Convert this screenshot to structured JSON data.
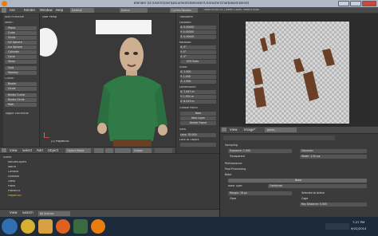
{
  "window": {
    "title": "Blender [D:\\Users\\User\\Documents\\Blender\\Character\\charbaked.blend]"
  },
  "info_header": {
    "menus": [
      "File",
      "Render",
      "Window",
      "Help"
    ],
    "layout": "Default",
    "scene": "Scene",
    "engine": "Cycles Render",
    "stats": "Time:00:00.00 | Mem:0.80M, Peak:0.80M"
  },
  "tool_shelf": {
    "add_primitive_label": "Add Primitive",
    "mesh_label": "Mesh:",
    "mesh_items": [
      "Plane",
      "Cube",
      "Circle",
      "UV Sphere",
      "Ico Sphere",
      "Cylinder",
      "Cone",
      "Torus",
      "Grid",
      "Monkey"
    ],
    "curve_label": "Curve:",
    "curve_items": [
      "Bezier",
      "Circle",
      "Nurbs Curve",
      "Nurbs Circle",
      "Path"
    ],
    "toggle_label": "Toggle Editmode"
  },
  "viewport": {
    "view_label": "User Persp",
    "object_label": "(1) Player001",
    "header_menus": [
      "View",
      "Select",
      "Add",
      "Object"
    ],
    "mode": "Object Mode",
    "orientation": "Global"
  },
  "n_panel": {
    "transform": "Transform",
    "location": "Location:",
    "loc": [
      "X:",
      "0.00000",
      "Y:",
      "0.00000",
      "Z:",
      "0.00000"
    ],
    "rotation": "Rotation:",
    "rot": [
      "X:",
      "0°",
      "Y:",
      "0°",
      "Z:",
      "0°"
    ],
    "rot_mode": "XYZ Euler",
    "scale": "Scale:",
    "scl": [
      "X:",
      "1.000",
      "Y:",
      "1.000",
      "Z:",
      "1.000"
    ],
    "dimensions": "Dimensions:",
    "dims": [
      "X:",
      "7.847 m",
      "Y:",
      "1.954 m",
      "Z:",
      "8.513 m"
    ],
    "grease_pencil": "Grease Pencil",
    "new_label": "New",
    "new_layer": "New Layer",
    "delete_frame": "Delete Frame",
    "view_label": "View",
    "lens_label": "Lens:",
    "lens_value": "35.000",
    "lock_label": "Lock to Object:"
  },
  "image_editor": {
    "header_menus": [
      "View",
      "Image*"
    ],
    "image_name": "pants"
  },
  "properties": {
    "sampling": "Sampling",
    "exposure_label": "Exposure:",
    "exposure_value": "1.000",
    "filter_label": "Gaussian",
    "transparent_label": "Transparent",
    "width_label": "Width:",
    "width_value": "1.50 px",
    "performance": "Performance",
    "post_processing": "Post Processing",
    "bake": "Bake",
    "bake_button": "Bake",
    "bake_type_label": "Bake Type:",
    "bake_type_value": "Combined",
    "margin_label": "Margin:",
    "margin_value": "16 px",
    "selected_to_active": "Selected to Active",
    "clear_label": "Clear",
    "cage_label": "Cage",
    "ray_distance": "Ray Distance:",
    "ray_value": "0.000"
  },
  "outliner": {
    "rows": [
      "Scene",
      "RenderLayers",
      "World",
      "Camera",
      "Eyeballs",
      "Lamp",
      "Plane",
      "Plane001",
      "Player001"
    ],
    "footer": [
      "View",
      "Search",
      "All Scenes"
    ]
  },
  "taskbar": {
    "time": "7:27 PM",
    "date": "9/22/2014"
  },
  "colors": {
    "blender_bg": "#393939",
    "shirt": "#2e7a45",
    "skin": "#c9a98a",
    "taskbar": "#1c2a3a",
    "pants_texture": "#6b3f25"
  }
}
